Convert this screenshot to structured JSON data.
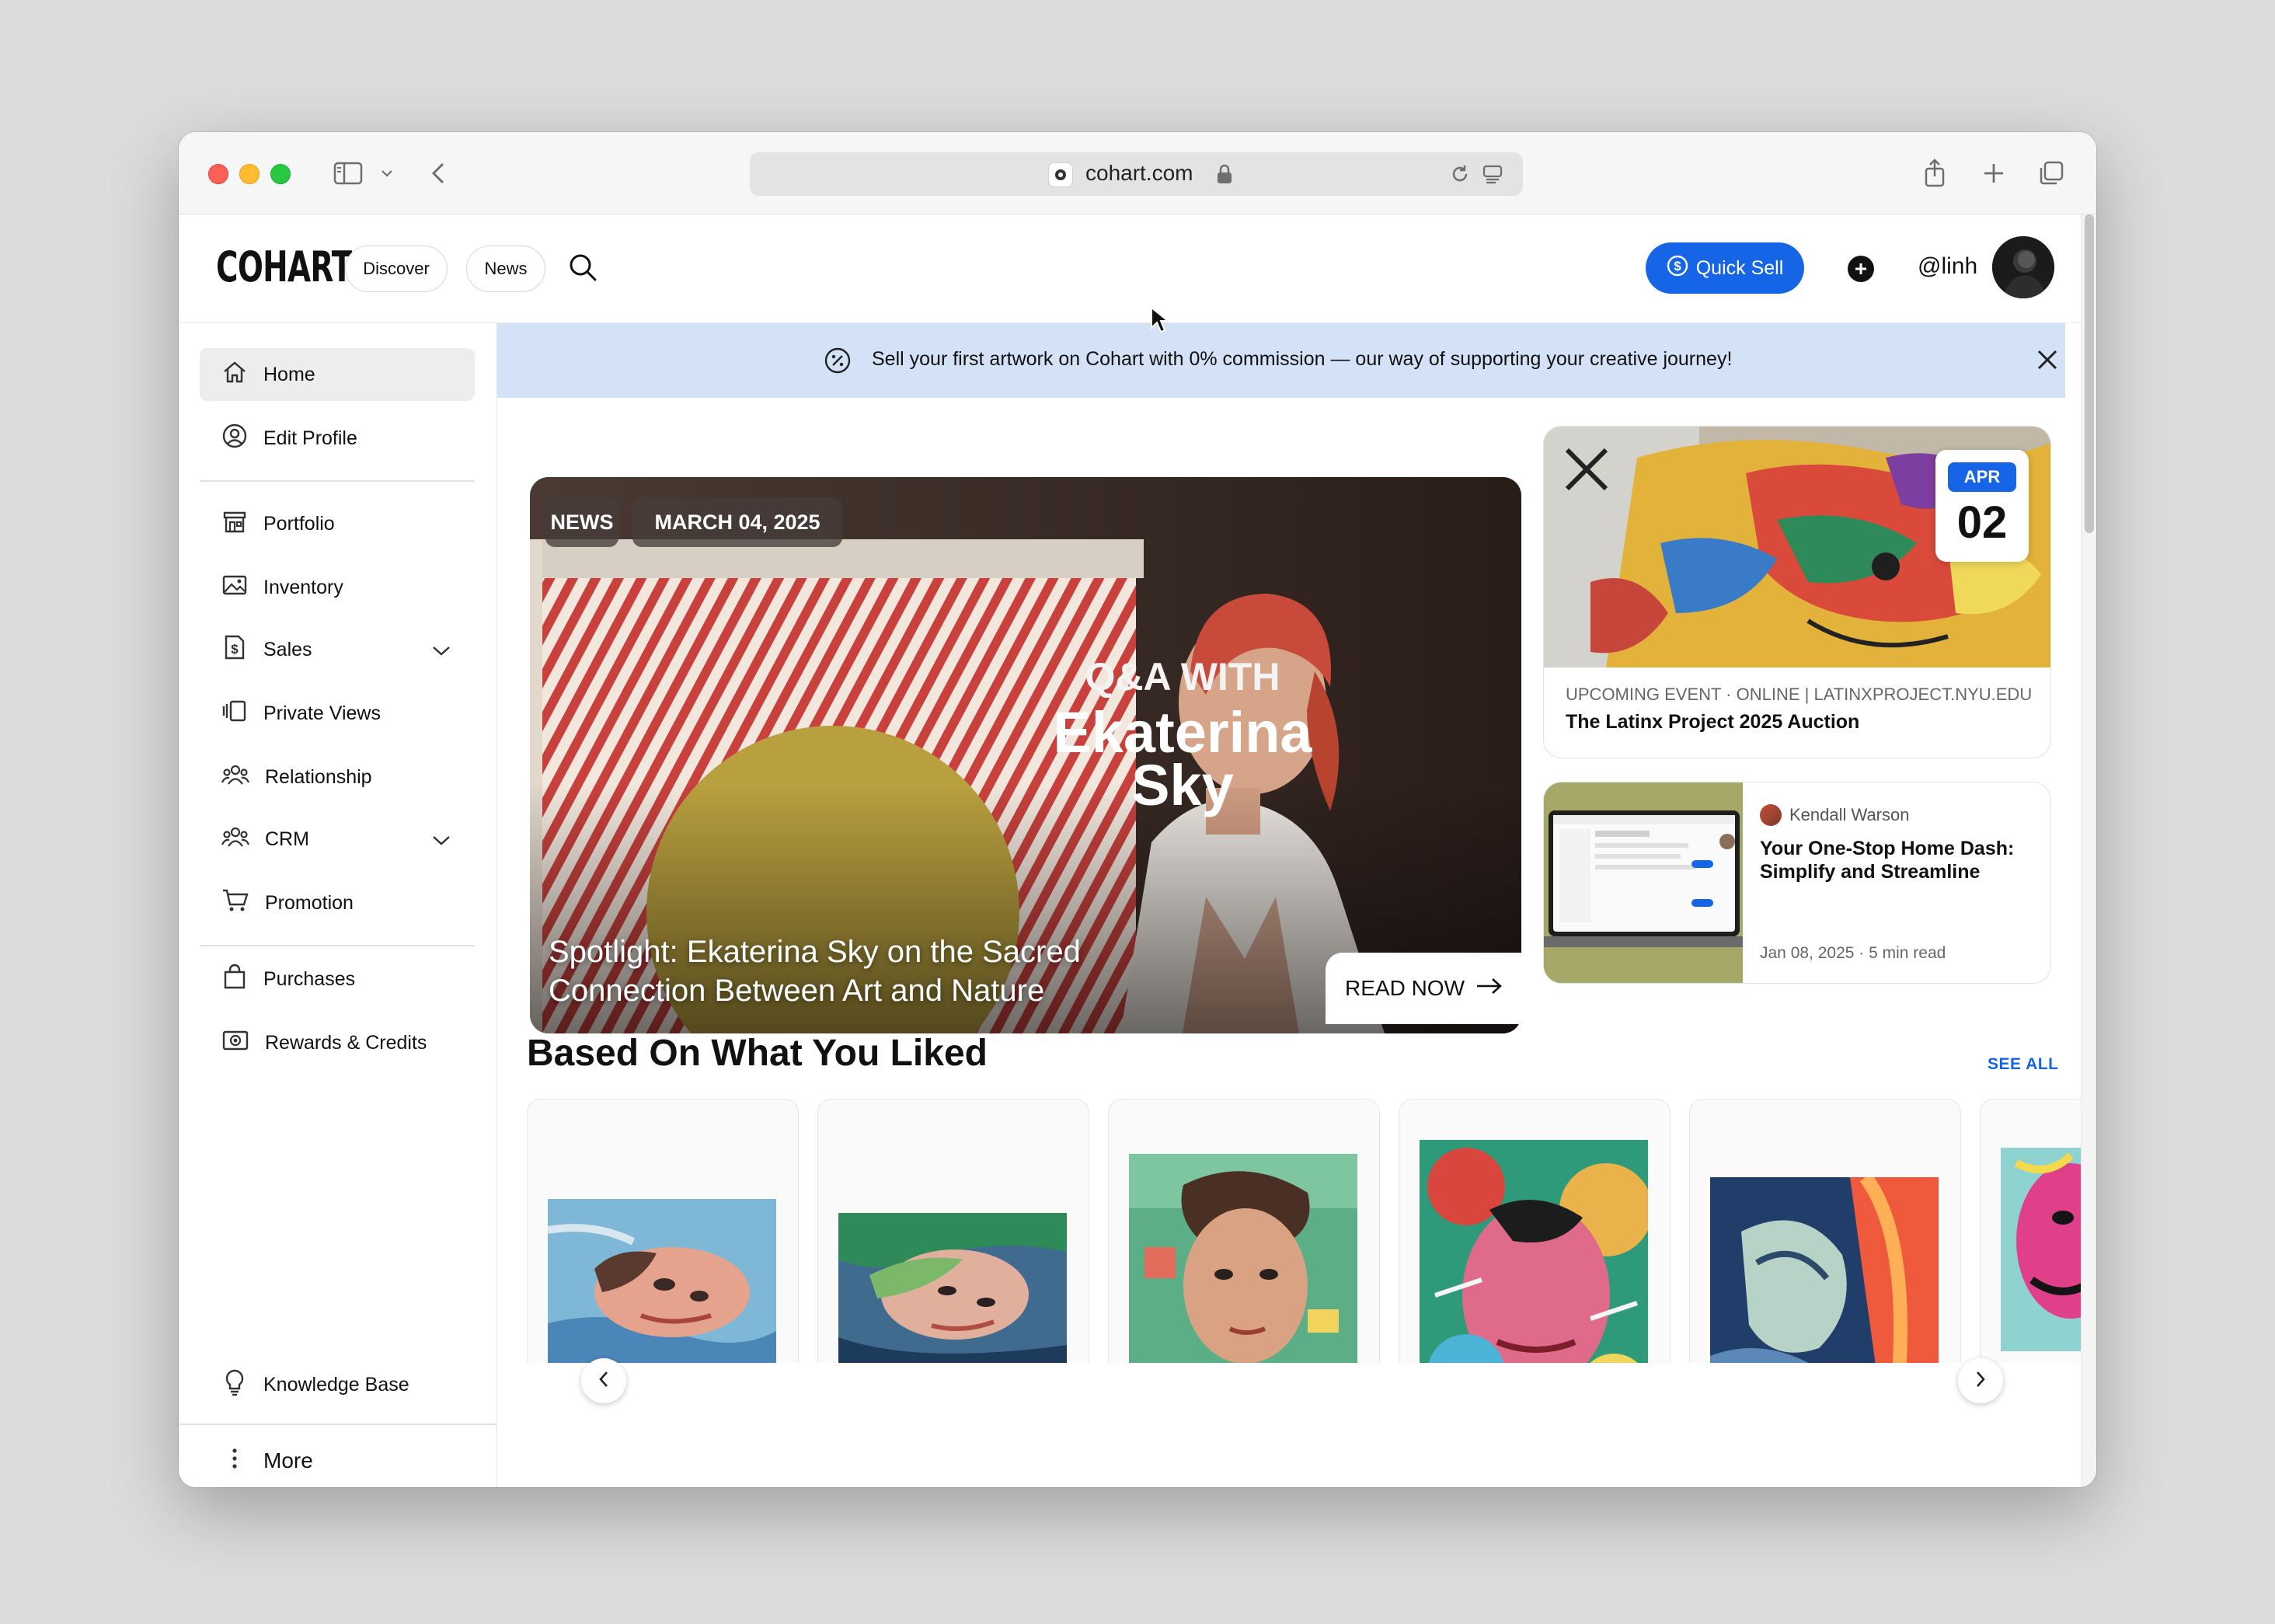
{
  "browser": {
    "url": "cohart.com"
  },
  "header": {
    "logo": "COHART",
    "nav": [
      "Discover",
      "News"
    ],
    "quick_sell_label": "Quick Sell",
    "username": "@linh"
  },
  "sidebar": {
    "items": [
      {
        "label": "Home",
        "icon": "home-icon"
      },
      {
        "label": "Edit Profile",
        "icon": "user-circle-icon"
      },
      {
        "label": "Portfolio",
        "icon": "storefront-icon"
      },
      {
        "label": "Inventory",
        "icon": "image-icon"
      },
      {
        "label": "Sales",
        "icon": "dollar-doc-icon"
      },
      {
        "label": "Private Views",
        "icon": "private-views-icon"
      },
      {
        "label": "Relationship",
        "icon": "people-icon"
      },
      {
        "label": "CRM",
        "icon": "people-icon"
      },
      {
        "label": "Promotion",
        "icon": "cart-icon"
      },
      {
        "label": "Purchases",
        "icon": "bag-icon"
      },
      {
        "label": "Rewards & Credits",
        "icon": "rewards-icon"
      }
    ],
    "knowledge_base": "Knowledge Base",
    "more": "More"
  },
  "banner": {
    "text": "Sell your first artwork on Cohart with 0% commission — our way of supporting your creative journey!"
  },
  "hero": {
    "tag": "NEWS",
    "date": "MARCH 04, 2025",
    "overlay_line1": "Q&A WITH",
    "overlay_line2": "Ekaterina",
    "overlay_line3": "Sky",
    "title_line1": "Spotlight: Ekaterina Sky on the Sacred",
    "title_line2": "Connection Between Art and Nature",
    "cta": "READ NOW"
  },
  "event": {
    "month": "APR",
    "day": "02",
    "meta": "UPCOMING EVENT · ONLINE | LATINXPROJECT.NYU.EDU",
    "title": "The Latinx Project 2025 Auction"
  },
  "article": {
    "author": "Kendall Warson",
    "title": "Your One-Stop Home Dash: Simplify and Streamline",
    "date": "Jan 08, 2025 · 5 min read"
  },
  "section": {
    "title": "Based On What You Liked",
    "see_all": "SEE ALL"
  },
  "colors": {
    "accent": "#1565e6",
    "banner_bg": "#d3e2f7",
    "active_nav": "#ededed"
  }
}
